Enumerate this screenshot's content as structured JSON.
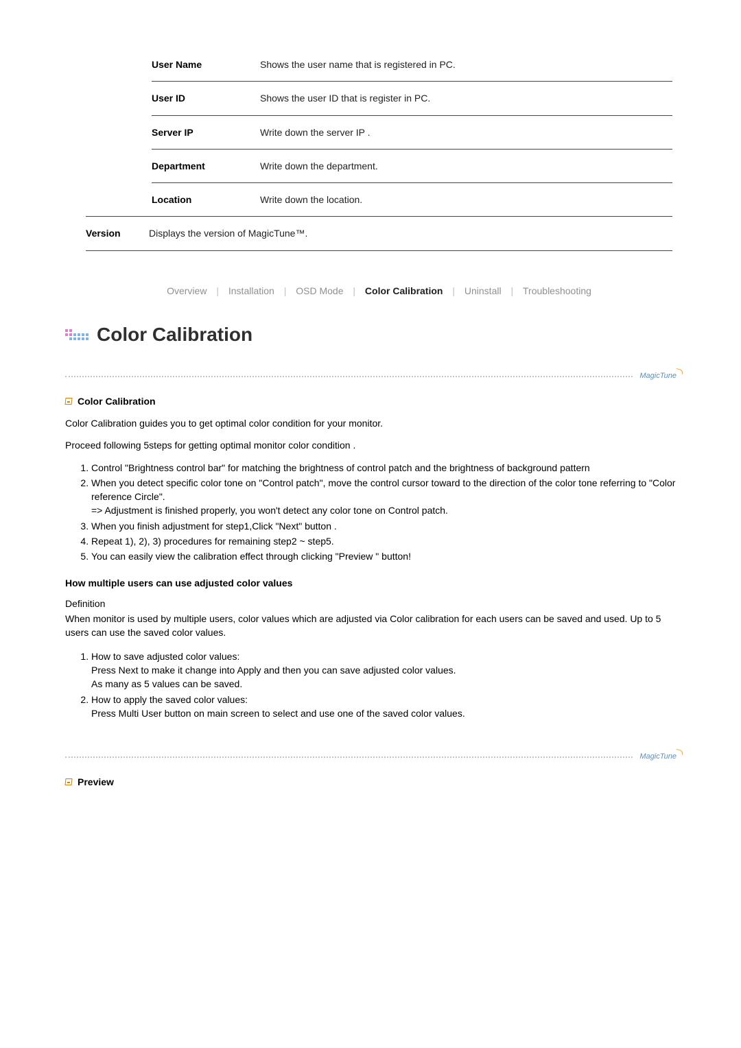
{
  "table": {
    "rows": [
      {
        "label": "User Name",
        "desc": "Shows the user name that is registered in PC."
      },
      {
        "label": "User ID",
        "desc": "Shows the user ID that is register in PC."
      },
      {
        "label": "Server IP",
        "desc": "Write down the server IP ."
      },
      {
        "label": "Department",
        "desc": "Write down the department."
      },
      {
        "label": "Location",
        "desc": "Write down the location."
      }
    ],
    "version_label": "Version",
    "version_desc": "Displays the version of MagicTune™."
  },
  "nav": {
    "items": [
      "Overview",
      "Installation",
      "OSD Mode",
      "Color Calibration",
      "Uninstall",
      "Troubleshooting"
    ],
    "active": "Color Calibration"
  },
  "heading": "Color Calibration",
  "logo_text": "MagicTune",
  "section1": {
    "title": "Color Calibration",
    "p1": "Color Calibration guides you to get optimal color condition for your monitor.",
    "p2": "Proceed following 5steps for getting optimal monitor color condition .",
    "steps": [
      "Control \"Brightness control bar\" for matching the brightness of control patch and the brightness of background pattern",
      "When you detect specific color tone on \"Control patch\", move the control cursor toward to the direction of the color tone referring to \"Color reference Circle\".",
      "When you finish adjustment for step1,Click \"Next\" button .",
      "Repeat 1), 2), 3) procedures for remaining step2 ~ step5.",
      "You can easily view the calibration effect through clicking \"Preview \" button!"
    ],
    "step2_extra": "=> Adjustment is finished properly, you won't detect any color tone on Control patch.",
    "multi_title": "How multiple users can use adjusted color values",
    "def_label": "Definition",
    "def_text": "When monitor is used by multiple users, color values which are adjusted via Color calibration for each users can be saved and used. Up to 5 users can use the saved color values.",
    "howto": [
      {
        "head": "How to save adjusted color values:",
        "lines": [
          "Press Next to make it change into Apply and then you can save adjusted color values.",
          "As many as 5 values can be saved."
        ]
      },
      {
        "head": "How to apply the saved color values:",
        "lines": [
          "Press Multi User button on main screen to select and use one of the saved color values."
        ]
      }
    ]
  },
  "section2_title": "Preview"
}
